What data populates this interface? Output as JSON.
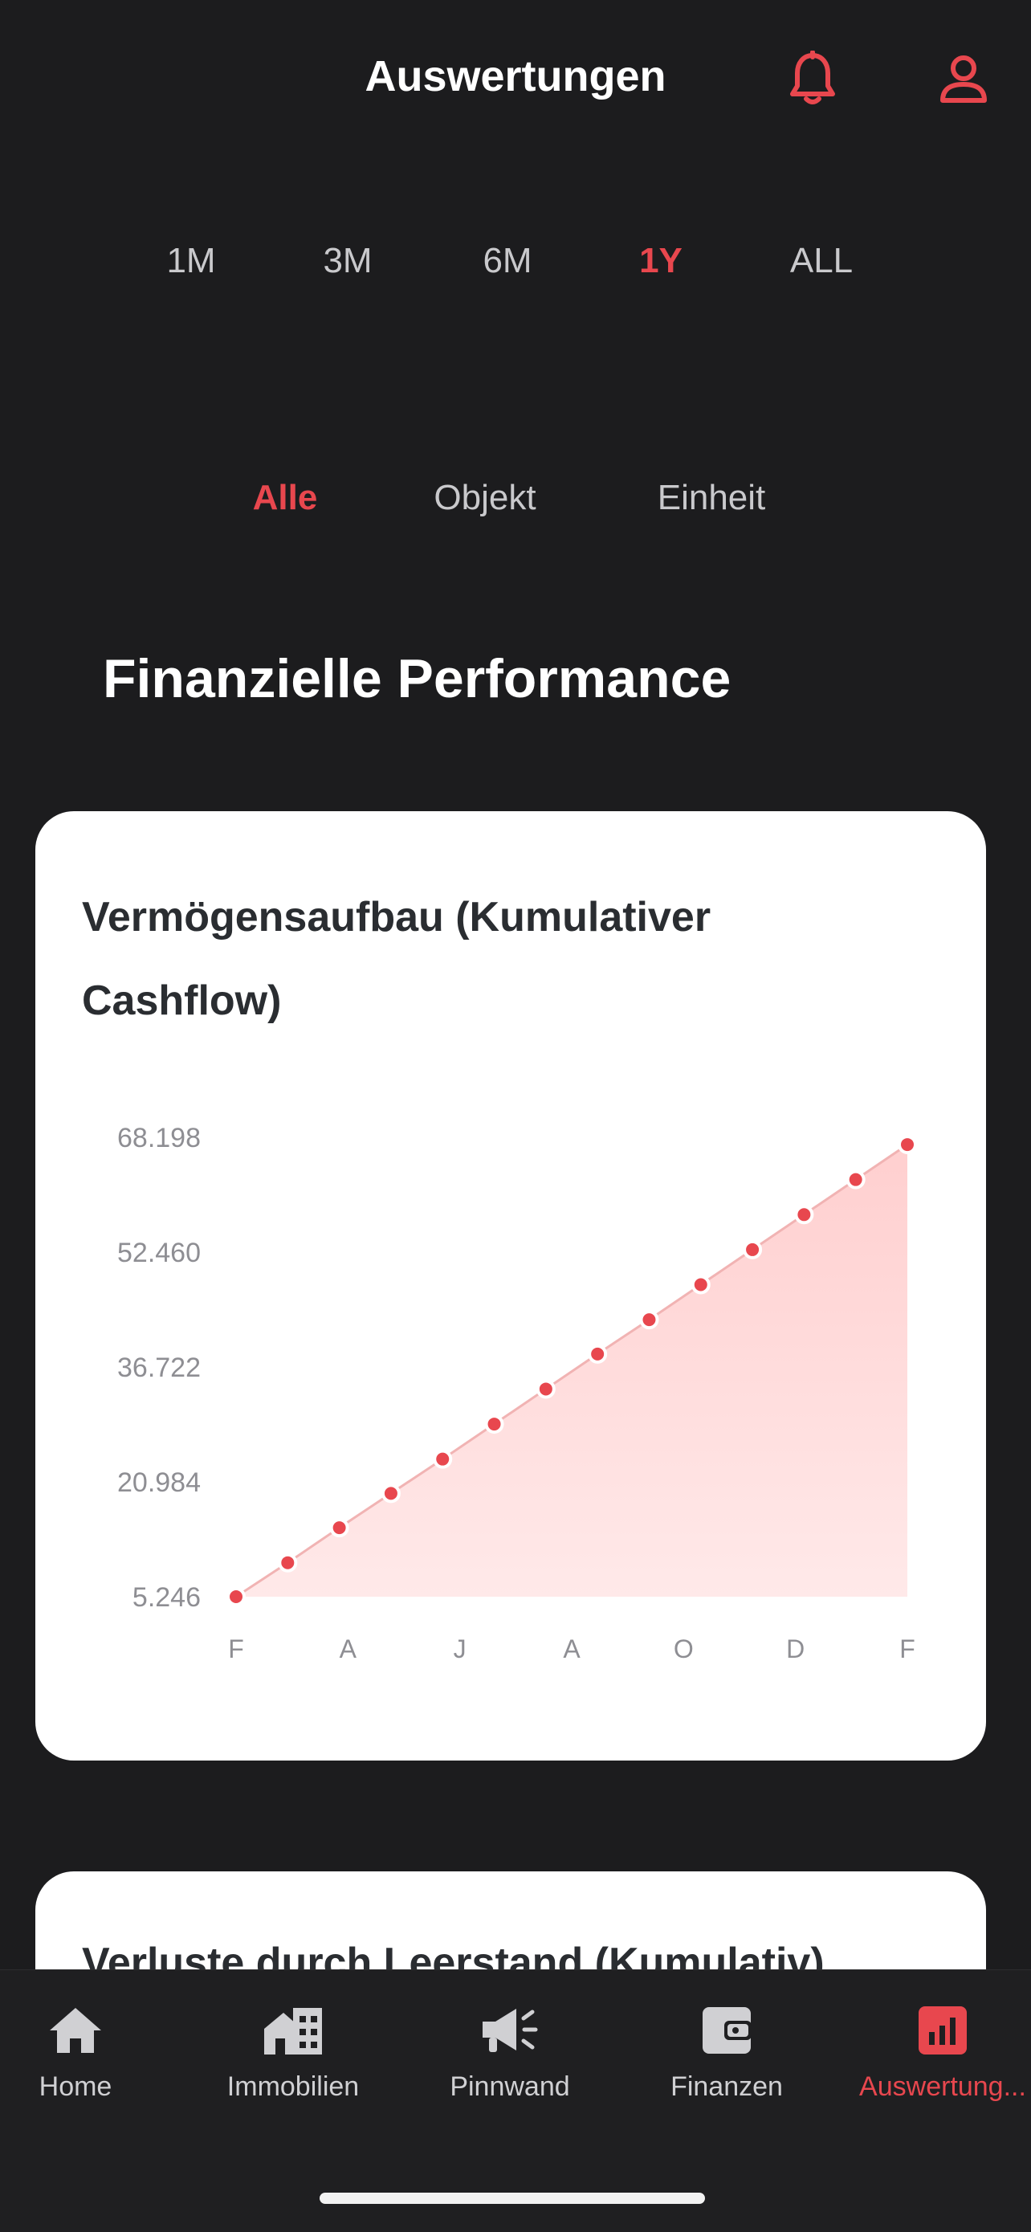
{
  "header": {
    "title": "Auswertungen"
  },
  "range_tabs": [
    "1M",
    "3M",
    "6M",
    "1Y",
    "ALL"
  ],
  "range_active": "1Y",
  "scope_tabs": [
    "Alle",
    "Objekt",
    "Einheit"
  ],
  "scope_active": "Alle",
  "section_title": "Finanzielle Performance",
  "cards": {
    "wealth_title": "Vermögensaufbau (Kumulativer Cashflow)",
    "vacancy_title": "Verluste durch Leerstand (Kumulativ)"
  },
  "chart_data": {
    "type": "area",
    "title": "Vermögensaufbau (Kumulativer Cashflow)",
    "x_tick_labels": [
      "F",
      "A",
      "J",
      "A",
      "O",
      "D",
      "F"
    ],
    "y_tick_labels": [
      "68.198",
      "52.460",
      "36.722",
      "20.984",
      "5.246"
    ],
    "ylim": [
      5246,
      68198
    ],
    "series": [
      {
        "values": [
          5246,
          9900,
          14700,
          19400,
          24100,
          28900,
          33700,
          38500,
          43200,
          48000,
          52800,
          57600,
          62400,
          67200
        ]
      }
    ],
    "grid": false,
    "colors": {
      "line": "#e8474e",
      "fill": "#ffd6d6",
      "point": "#e8474e"
    }
  },
  "tabbar": {
    "items": [
      {
        "label": "Home",
        "icon": "home-icon"
      },
      {
        "label": "Immobilien",
        "icon": "building-icon"
      },
      {
        "label": "Pinnwand",
        "icon": "megaphone-icon"
      },
      {
        "label": "Finanzen",
        "icon": "wallet-icon"
      },
      {
        "label": "Auswertung...",
        "icon": "chart-icon"
      }
    ],
    "active_index": 4
  },
  "colors": {
    "accent": "#e8474e",
    "background": "#1c1c1e",
    "card": "#ffffff"
  }
}
